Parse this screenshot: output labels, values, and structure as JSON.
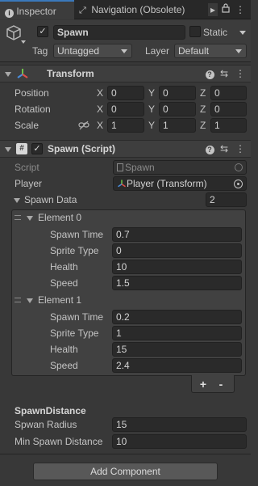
{
  "tabs": {
    "inspector": "Inspector",
    "navigation": "Navigation (Obsolete)"
  },
  "gameobject": {
    "name": "Spawn",
    "active": true,
    "static_label": "Static",
    "static": false,
    "tag_label": "Tag",
    "tag_value": "Untagged",
    "layer_label": "Layer",
    "layer_value": "Default"
  },
  "transform": {
    "title": "Transform",
    "position_label": "Position",
    "rotation_label": "Rotation",
    "scale_label": "Scale",
    "x": "X",
    "y": "Y",
    "z": "Z",
    "position": [
      "0",
      "0",
      "0"
    ],
    "rotation": [
      "0",
      "0",
      "0"
    ],
    "scale": [
      "1",
      "1",
      "1"
    ]
  },
  "script": {
    "title": "Spawn (Script)",
    "enabled": true,
    "script_label": "Script",
    "script_value": "Spawn",
    "player_label": "Player",
    "player_value": "Player (Transform)",
    "spawn_data_label": "Spawn Data",
    "spawn_data_count": "2",
    "elements": [
      {
        "title": "Element 0",
        "spawn_time_label": "Spawn Time",
        "spawn_time": "0.7",
        "sprite_type_label": "Sprite Type",
        "sprite_type": "0",
        "health_label": "Health",
        "health": "10",
        "speed_label": "Speed",
        "speed": "1.5"
      },
      {
        "title": "Element 1",
        "spawn_time_label": "Spawn Time",
        "spawn_time": "0.2",
        "sprite_type_label": "Sprite Type",
        "sprite_type": "1",
        "health_label": "Health",
        "health": "15",
        "speed_label": "Speed",
        "speed": "2.4"
      }
    ],
    "add_label": "+",
    "remove_label": "-",
    "section_header": "SpawnDistance",
    "spawn_radius_label": "Spwan Radius",
    "spawn_radius": "15",
    "min_spawn_distance_label": "Min Spawn Distance",
    "min_spawn_distance": "10"
  },
  "add_component_label": "Add Component",
  "colors": {
    "accent": "#3a79bb",
    "panel": "#383838",
    "field": "#2a2a2a"
  }
}
